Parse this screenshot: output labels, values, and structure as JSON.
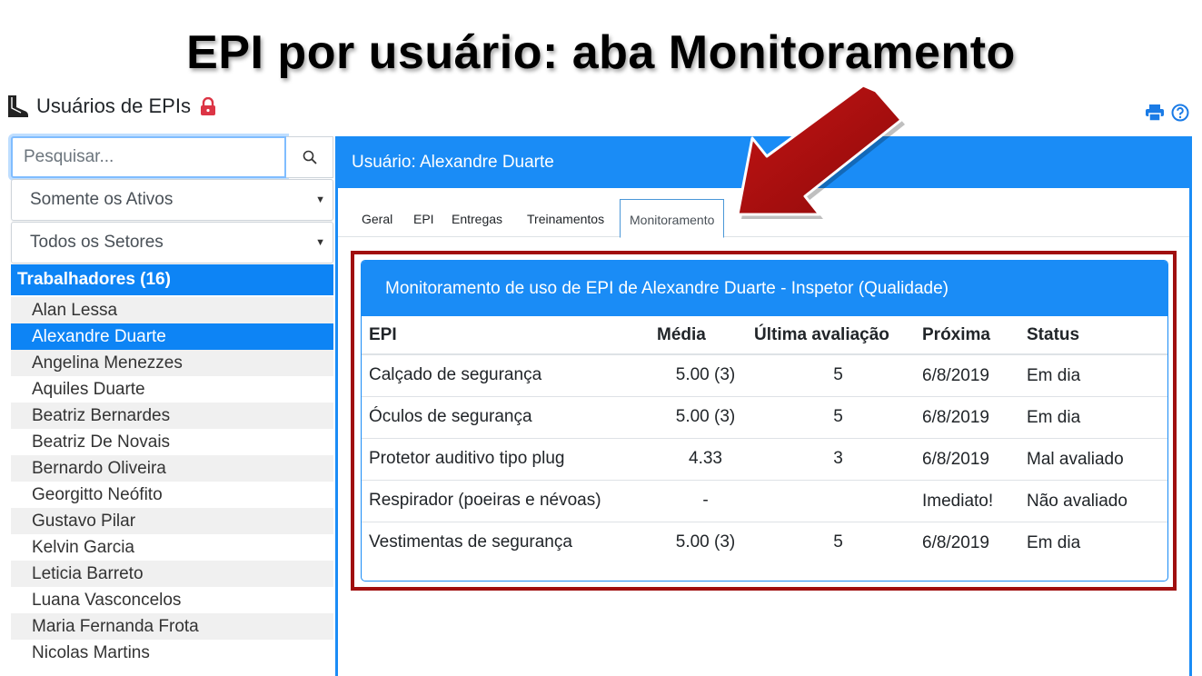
{
  "slide": {
    "title": "EPI por usuário: aba Monitoramento"
  },
  "app": {
    "title": "Usuários de EPIs"
  },
  "colors": {
    "primary": "#1a8cf6",
    "danger": "#dc3545",
    "highlight": "#a00f0f",
    "link": "#1a7be6"
  },
  "icons": [
    "boot-icon",
    "lock-icon",
    "print-icon",
    "help-icon",
    "search-icon",
    "arrow-icon"
  ],
  "sidebar": {
    "search": {
      "placeholder": "Pesquisar...",
      "value": ""
    },
    "filter_status": "Somente os Ativos",
    "filter_sector": "Todos os Setores",
    "list_header": "Trabalhadores (16)",
    "workers": [
      "Alan Lessa",
      "Alexandre Duarte",
      "Angelina Menezzes",
      "Aquiles Duarte",
      "Beatriz Bernardes",
      "Beatriz De Novais",
      "Bernardo Oliveira",
      "Georgitto Neófito",
      "Gustavo Pilar",
      "Kelvin Garcia",
      "Leticia Barreto",
      "Luana Vasconcelos",
      "Maria Fernanda Frota",
      "Nicolas Martins"
    ],
    "selected_worker": "Alexandre Duarte"
  },
  "main": {
    "panel_title": "Usuário: Alexandre Duarte",
    "tabs": [
      "Geral",
      "EPI",
      "Entregas",
      "Treinamentos",
      "Monitoramento"
    ],
    "active_tab": "Monitoramento",
    "card": {
      "title": "Monitoramento de uso de EPI de Alexandre Duarte - Inspetor (Qualidade)",
      "columns": [
        "EPI",
        "Média",
        "Última avaliação",
        "Próxima",
        "Status"
      ],
      "rows": [
        {
          "epi": "Calçado de segurança",
          "media": "5.00 (3)",
          "ultima": "5",
          "proxima": "6/8/2019",
          "status": "Em dia"
        },
        {
          "epi": "Óculos de segurança",
          "media": "5.00 (3)",
          "ultima": "5",
          "proxima": "6/8/2019",
          "status": "Em dia"
        },
        {
          "epi": "Protetor auditivo tipo plug",
          "media": "4.33",
          "ultima": "3",
          "proxima": "6/8/2019",
          "status": "Mal avaliado"
        },
        {
          "epi": "Respirador (poeiras e névoas)",
          "media": "-",
          "ultima": "",
          "proxima": "Imediato!",
          "status": "Não avaliado"
        },
        {
          "epi": "Vestimentas de segurança",
          "media": "5.00 (3)",
          "ultima": "5",
          "proxima": "6/8/2019",
          "status": "Em dia"
        }
      ]
    }
  }
}
